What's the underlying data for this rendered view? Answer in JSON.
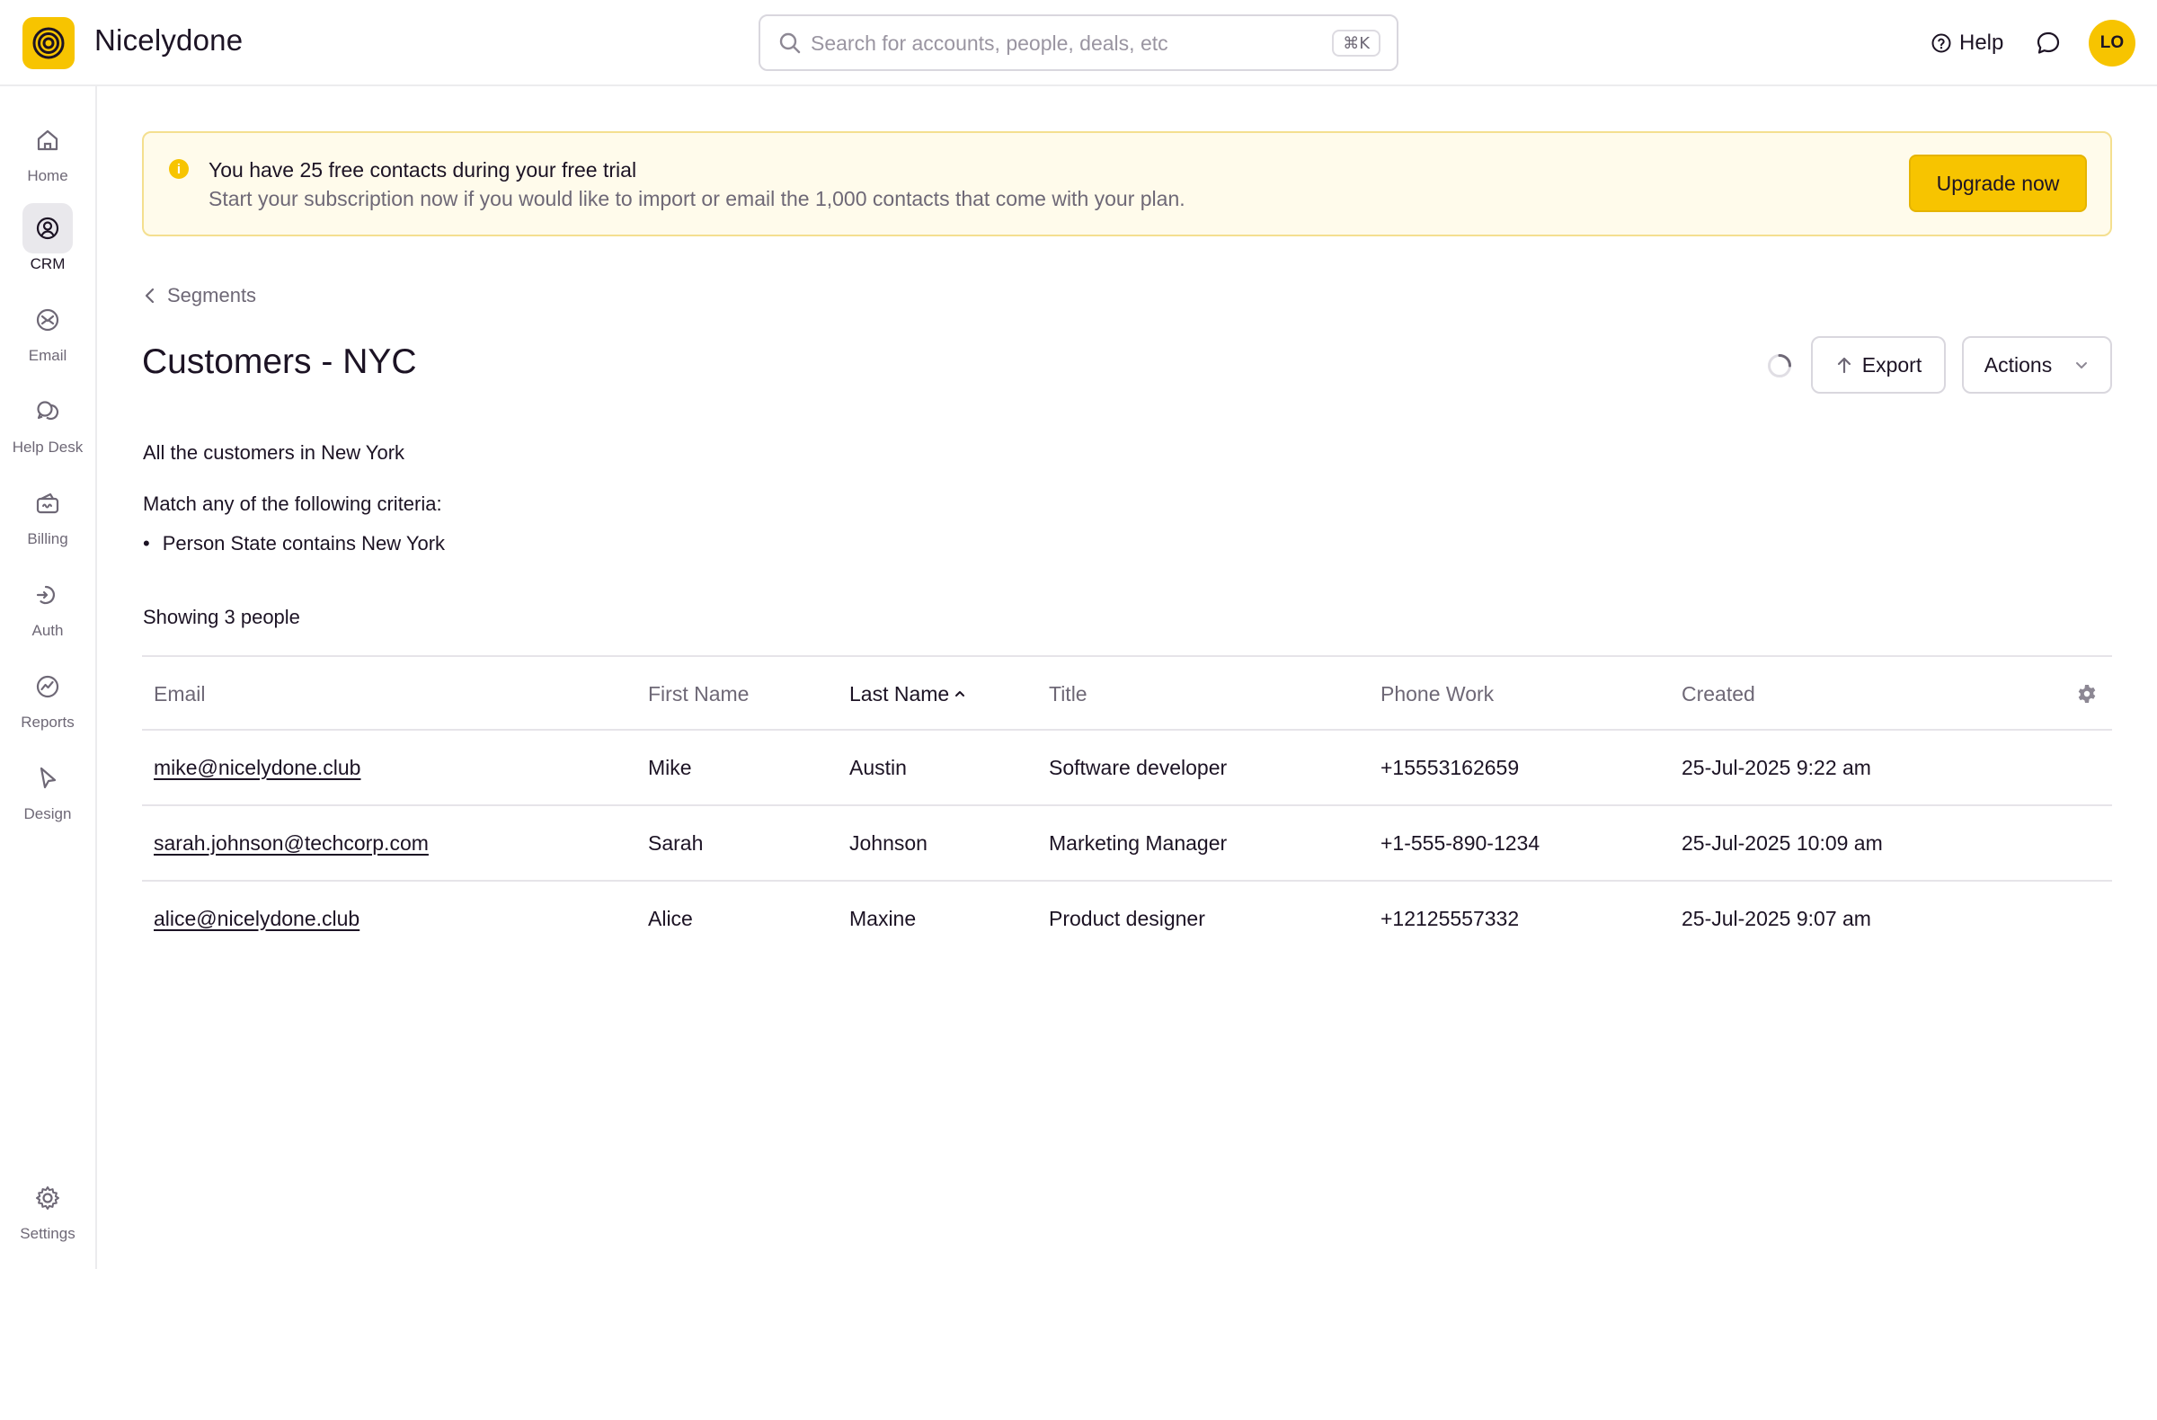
{
  "app": {
    "name": "Nicelydone",
    "logo_icon": "spiral-logo-icon",
    "accent_color": "#f7c400"
  },
  "header": {
    "search": {
      "placeholder": "Search for accounts, people, deals, etc",
      "value": "",
      "shortcut": "⌘K"
    },
    "help_label": "Help",
    "avatar_initials": "LO"
  },
  "sidebar": {
    "items": [
      {
        "label": "Home",
        "icon": "home-icon",
        "active": false
      },
      {
        "label": "CRM",
        "icon": "contact-icon",
        "active": true
      },
      {
        "label": "Email",
        "icon": "email-icon",
        "active": false
      },
      {
        "label": "Help Desk",
        "icon": "chat-bubbles-icon",
        "active": false
      },
      {
        "label": "Billing",
        "icon": "wallet-icon",
        "active": false
      },
      {
        "label": "Auth",
        "icon": "auth-icon",
        "active": false
      },
      {
        "label": "Reports",
        "icon": "chart-icon",
        "active": false
      },
      {
        "label": "Design",
        "icon": "cursor-icon",
        "active": false
      }
    ],
    "settings_label": "Settings"
  },
  "banner": {
    "title": "You have 25 free contacts during your free trial",
    "text": "Start your subscription now if you would like to import or email the 1,000 contacts that come with your plan.",
    "button_label": "Upgrade now"
  },
  "page": {
    "breadcrumb": "Segments",
    "title": "Customers - NYC",
    "export_label": "Export",
    "actions_label": "Actions",
    "description": "All the customers in New York",
    "criteria_heading": "Match any of the following criteria:",
    "criteria": [
      {
        "field": "Person State",
        "operator": "contains",
        "value": "New York"
      }
    ],
    "showing_text": "Showing 3 people"
  },
  "table": {
    "columns": [
      "Email",
      "First Name",
      "Last Name",
      "Title",
      "Phone Work",
      "Created"
    ],
    "sorted_column": "Last Name",
    "sort_direction": "ascending",
    "rows": [
      [
        "mike@nicelydone.club",
        "Mike",
        "Austin",
        "Software developer",
        "+15553162659",
        "25-Jul-2025 9:22 am"
      ],
      [
        "sarah.johnson@techcorp.com",
        "Sarah",
        "Johnson",
        "Marketing Manager",
        "+1-555-890-1234",
        "25-Jul-2025 10:09 am"
      ],
      [
        "alice@nicelydone.club",
        "Alice",
        "Maxine",
        "Product designer",
        "+12125557332",
        "25-Jul-2025 9:07 am"
      ]
    ]
  }
}
